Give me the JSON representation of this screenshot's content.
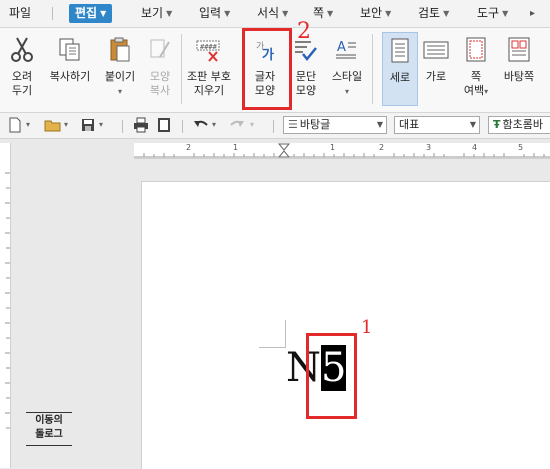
{
  "menubar": {
    "items": [
      {
        "label": "파일",
        "caret": false,
        "active": false
      },
      {
        "label": "편집",
        "caret": true,
        "active": true
      },
      {
        "label": "보기",
        "caret": true,
        "active": false
      },
      {
        "label": "입력",
        "caret": true,
        "active": false
      },
      {
        "label": "서식",
        "caret": true,
        "active": false
      },
      {
        "label": "쪽",
        "caret": true,
        "active": false
      },
      {
        "label": "보안",
        "caret": true,
        "active": false
      },
      {
        "label": "검토",
        "caret": true,
        "active": false
      },
      {
        "label": "도구",
        "caret": true,
        "active": false
      }
    ]
  },
  "ribbon": {
    "cut": "오려\n두기",
    "copy": "복사하기",
    "paste": "붙이기",
    "format_copy": "모양\n복사",
    "clear_markup": "조판 부호\n지우기",
    "char_shape": "글자\n모양",
    "char_shape_icon_text": "가",
    "para_shape": "문단\n모양",
    "style": "스타일",
    "vertical": "세로",
    "horizontal": "가로",
    "page_margin": "쪽\n여백",
    "page_bg": "바탕쪽"
  },
  "toolbar2": {
    "style_value": "바탕글",
    "lang_value": "대표",
    "font_value": "함초롬바"
  },
  "ruler": {
    "ticks": [
      "2",
      "1",
      "1",
      "2",
      "3",
      "4",
      "5"
    ]
  },
  "document": {
    "text_before": "N",
    "selected_text": "5"
  },
  "annotations": {
    "step1": "1",
    "step2": "2",
    "color": "#e32a2a"
  },
  "move_tag": {
    "line1": "이동의",
    "line2": "돌로그"
  }
}
